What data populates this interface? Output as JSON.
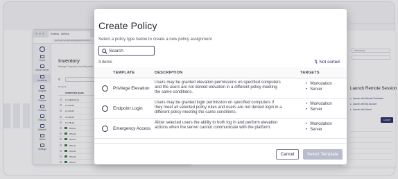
{
  "browser": {
    "tab_title": "Endless - Delinea",
    "url": "secretserver.delinea.app/app/inventory",
    "nav": [
      "Home",
      "Secret Server",
      "Inventory",
      "Insights",
      "Policies",
      "Policies",
      "Remote",
      "Network",
      "Others",
      "Settings"
    ],
    "page_title": "Inventory",
    "page_subtitle": "Manage Computers from this panel",
    "item_count": "25 items",
    "column_header": "COMPUTER NAME",
    "rows": [
      "LX-NR2013-01",
      "LX-R4-03",
      "LX-R3-03",
      "LX-R2-02",
      "LX-UB-01",
      "WS-01",
      "WS-02",
      "WS-03",
      "WS-04",
      "WS-05",
      "WS-06",
      "WS-07"
    ]
  },
  "right_panel": {
    "field1": "LABSERVER",
    "field2": "",
    "title": "Launch Remote Session",
    "options": [
      "Launch with Manual Credential",
      "Launch with My Account",
      "Launch with Secret"
    ],
    "button": "Cancel"
  },
  "modal": {
    "title": "Create Policy",
    "description": "Select a policy type below to create a new policy assignment",
    "search_placeholder": "Search",
    "item_count": "3 items",
    "sort_label": "Not sorted",
    "columns": {
      "template": "TEMPLATE",
      "description": "DESCRIPTION",
      "targets": "TARGETS"
    },
    "rows": [
      {
        "template": "Privilege Elevation",
        "description": "Users may be granted elevation permissions on specified computers and the users are not denied elevation in a different policy meeting the same conditions.",
        "targets": [
          "Workstation",
          "Server"
        ]
      },
      {
        "template": "Endpoint Login",
        "description": "Users may be granted login permission on specified computers if they meet all selected policy rules and users are not denied login in a different policy meeting the same conditions.",
        "targets": [
          "Workstation",
          "Server"
        ]
      },
      {
        "template": "Emergency Access",
        "description": "Allow selected users the ability to both log in and perform elevation actions when the server cannot communicate with the platform.",
        "targets": [
          "Workstation",
          "Server"
        ]
      }
    ],
    "cancel_label": "Cancel",
    "select_label": "Select Template"
  }
}
